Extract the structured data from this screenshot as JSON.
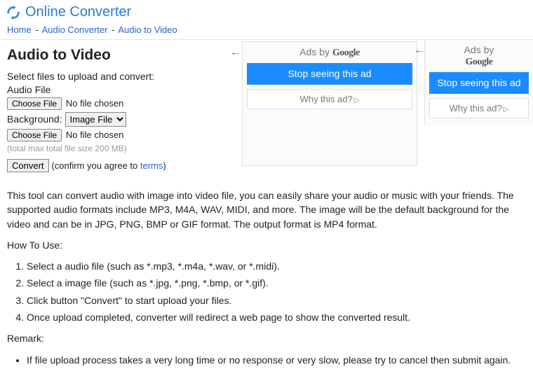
{
  "header": {
    "site_title": "Online Converter"
  },
  "breadcrumb": {
    "home": "Home",
    "cat": "Audio Converter",
    "page": "Audio to Video"
  },
  "page": {
    "title": "Audio to Video"
  },
  "form": {
    "select_label": "Select files to upload and convert:",
    "audio_label": "Audio File",
    "choose_file": "Choose File",
    "no_file": "No file chosen",
    "bg_label": "Background:",
    "bg_option": "Image File",
    "hint": "(total max total file size 200 MB)",
    "convert": "Convert",
    "confirm_prefix": "(confirm you agree to ",
    "terms": "terms",
    "confirm_suffix": ")"
  },
  "ads": {
    "by_prefix": "Ads by ",
    "google": "Google",
    "stop": "Stop seeing this ad",
    "why": "Why this ad?"
  },
  "desc": {
    "p1": "This tool can convert audio with image into video file, you can easily share your audio or music with your friends. The supported audio formats include MP3, M4A, WAV, MIDI, and more. The image will be the default background for the video and can be in JPG, PNG, BMP or GIF format. The output format is MP4 format.",
    "howto": "How To Use:",
    "steps": [
      "Select a audio file (such as *.mp3, *.m4a, *.wav, or *.midi).",
      "Select a image file (such as *.jpg, *.png, *.bmp, or *.gif).",
      "Click button \"Convert\" to start upload your files.",
      "Once upload completed, converter will redirect a web page to show the converted result."
    ],
    "remark": "Remark:",
    "bullets": [
      "If file upload process takes a very long time or no response or very slow, please try to cancel then submit again."
    ]
  }
}
